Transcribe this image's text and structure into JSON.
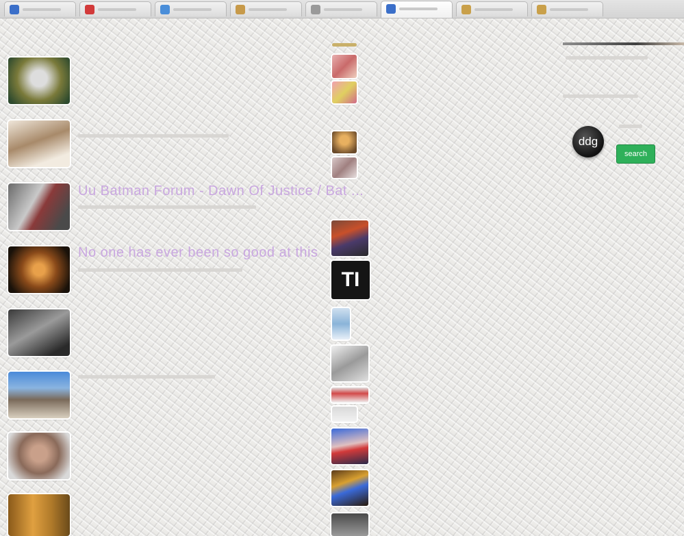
{
  "tabs": [
    {
      "favicon_color": "#3b6fc9",
      "active": false
    },
    {
      "favicon_color": "#d23a3a",
      "active": false
    },
    {
      "favicon_color": "#4a8ed9",
      "active": false
    },
    {
      "favicon_color": "#c79a4a",
      "active": false
    },
    {
      "favicon_color": "#9a9a9a",
      "active": false
    },
    {
      "favicon_color": "#3b6fc9",
      "active": true
    },
    {
      "favicon_color": "#c9a04a",
      "active": false
    },
    {
      "favicon_color": "#c9a04a",
      "active": false
    }
  ],
  "left_list": {
    "captions": {
      "item3": "Uu Batman Forum - Dawn Of Justice / Bat ...",
      "item4": "No one has ever been so good at this"
    }
  },
  "middle_list": {
    "logo_text": "TI"
  },
  "sidebar": {
    "logo_text": "ddg",
    "search_label": "search"
  }
}
